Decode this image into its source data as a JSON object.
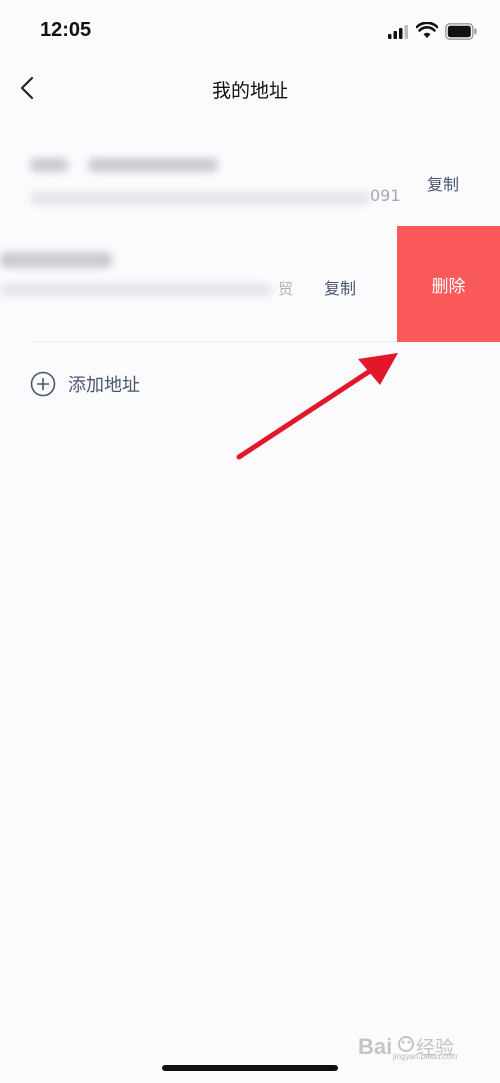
{
  "status_bar": {
    "time": "12:05"
  },
  "nav": {
    "title": "我的地址"
  },
  "addresses": [
    {
      "copy_label": "复制",
      "visible_fragment": "091"
    },
    {
      "copy_label": "复制",
      "visible_fragment": "贸",
      "delete_label": "删除"
    }
  ],
  "add_address": {
    "label": "添加地址"
  },
  "watermark": {
    "text": "jingyan.baidu.com"
  },
  "colors": {
    "delete_bg": "#fb5a5a",
    "accent_text": "#4a5570",
    "arrow": "#e2182a"
  }
}
